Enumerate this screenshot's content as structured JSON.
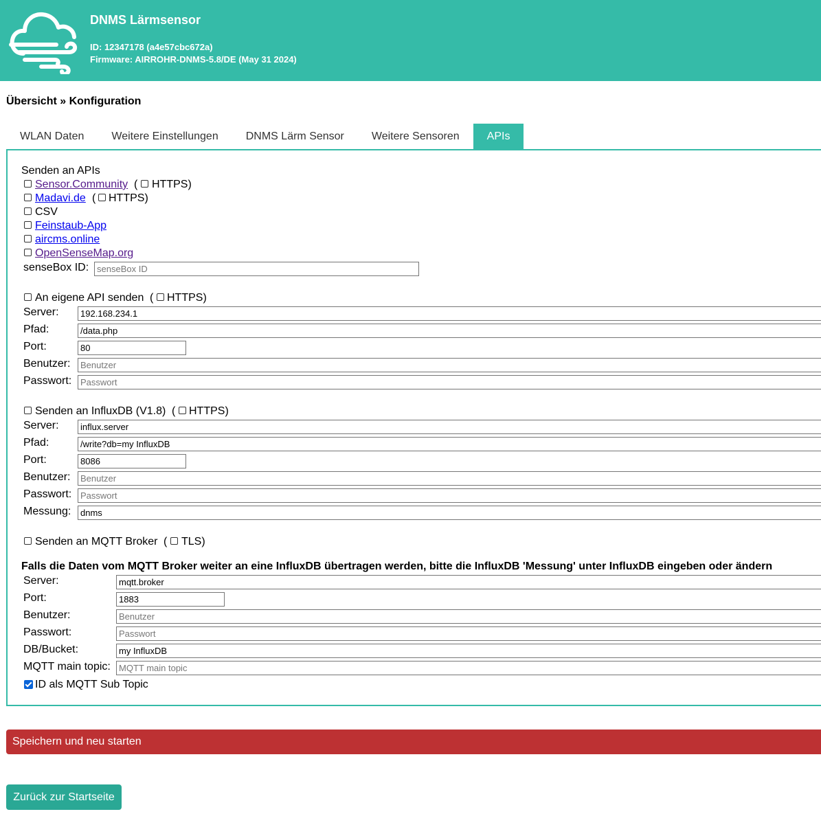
{
  "header": {
    "title": "DNMS Lärmsensor",
    "id_line": "ID: 12347178 (a4e57cbc672a)",
    "firmware_line": "Firmware: AIRROHR-DNMS-5.8/DE (May 31 2024)",
    "logo_icon": "cloud-wind-icon",
    "bg_color": "#35bba8"
  },
  "breadcrumb": "Übersicht » Konfiguration",
  "tabs": [
    {
      "label": "WLAN Daten",
      "active": false
    },
    {
      "label": "Weitere Einstellungen",
      "active": false
    },
    {
      "label": "DNMS Lärm Sensor",
      "active": false
    },
    {
      "label": "Weitere Sensoren",
      "active": false
    },
    {
      "label": "APIs",
      "active": true
    }
  ],
  "apis": {
    "heading": "Senden an APIs",
    "sensor_community": {
      "label": "Sensor.Community",
      "checked": false,
      "https_label": "HTTPS",
      "https_checked": false
    },
    "madavi": {
      "label": "Madavi.de",
      "checked": false,
      "https_label": "HTTPS",
      "https_checked": false
    },
    "csv": {
      "label": "CSV",
      "checked": false
    },
    "feinstaub": {
      "label": "Feinstaub-App",
      "checked": false
    },
    "aircms": {
      "label": "aircms.online",
      "checked": false
    },
    "opensensemap": {
      "label": "OpenSenseMap.org",
      "checked": false
    },
    "sensebox": {
      "label": "senseBox ID:",
      "value": "",
      "placeholder": "senseBox ID"
    }
  },
  "custom_api": {
    "label": "An eigene API senden",
    "checked": false,
    "https_label": "HTTPS",
    "https_checked": false,
    "server": {
      "label": "Server:",
      "value": "192.168.234.1"
    },
    "path": {
      "label": "Pfad:",
      "value": "/data.php"
    },
    "port": {
      "label": "Port:",
      "value": "80"
    },
    "user": {
      "label": "Benutzer:",
      "value": "",
      "placeholder": "Benutzer"
    },
    "password": {
      "label": "Passwort:",
      "value": "",
      "placeholder": "Passwort"
    }
  },
  "influx": {
    "label": "Senden an InfluxDB (V1.8)",
    "checked": false,
    "https_label": "HTTPS",
    "https_checked": false,
    "server": {
      "label": "Server:",
      "value": "influx.server"
    },
    "path": {
      "label": "Pfad:",
      "value": "/write?db=my InfluxDB"
    },
    "port": {
      "label": "Port:",
      "value": "8086"
    },
    "user": {
      "label": "Benutzer:",
      "value": "",
      "placeholder": "Benutzer"
    },
    "password": {
      "label": "Passwort:",
      "value": "",
      "placeholder": "Passwort"
    },
    "measurement": {
      "label": "Messung:",
      "value": "dnms"
    }
  },
  "mqtt": {
    "label": "Senden an MQTT Broker",
    "checked": false,
    "tls_label": "TLS",
    "tls_checked": false,
    "note": "Falls die Daten vom MQTT Broker weiter an eine InfluxDB übertragen werden, bitte die InfluxDB 'Messung' unter InfluxDB eingeben oder ändern",
    "server": {
      "label": "Server:",
      "value": "mqtt.broker"
    },
    "port": {
      "label": "Port:",
      "value": "1883"
    },
    "user": {
      "label": "Benutzer:",
      "value": "",
      "placeholder": "Benutzer"
    },
    "password": {
      "label": "Passwort:",
      "value": "",
      "placeholder": "Passwort"
    },
    "bucket": {
      "label": "DB/Bucket:",
      "value": "my InfluxDB"
    },
    "topic": {
      "label": "MQTT main topic:",
      "value": "",
      "placeholder": "MQTT main topic"
    },
    "id_subtopic": {
      "label": "ID als MQTT Sub Topic",
      "checked": true
    }
  },
  "buttons": {
    "save": "Speichern und neu starten",
    "save_color": "#bd3133",
    "back": "Zurück zur Startseite",
    "back_color": "#2aa895"
  }
}
